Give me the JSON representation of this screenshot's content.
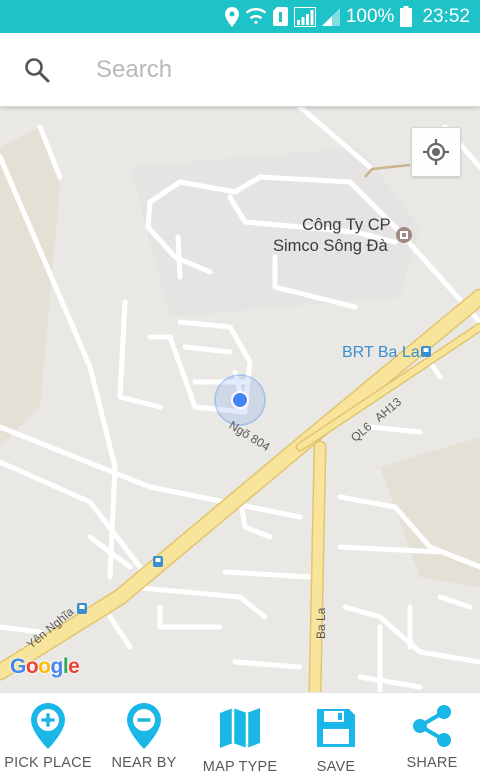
{
  "status_bar": {
    "battery_text": "100%",
    "time": "23:52",
    "icons": [
      "location-icon",
      "wifi-icon",
      "sim-icon",
      "signal-icon",
      "signal-icon",
      "battery-icon"
    ]
  },
  "search": {
    "placeholder": "Search",
    "icon": "search-icon"
  },
  "map": {
    "poi_name_line1": "Công Ty CP",
    "poi_name_line2": "Simco Sông Đà",
    "brt_station": "BRT Ba La",
    "road_ngo_804": "Ngõ 804",
    "road_ql6": "QL6",
    "road_ah13": "AH13",
    "road_ba_la": "Ba La",
    "road_yen_nghia": "Yên Nghĩa",
    "attribution": "Google",
    "colors": {
      "my_location_dot": "#4285f4",
      "highway": "#f8e49a",
      "land": "#e9e8e4"
    }
  },
  "bottom_nav": {
    "accent": "#1ab6e8",
    "items": [
      {
        "label": "PICK PLACE",
        "icon": "pin-plus-icon"
      },
      {
        "label": "NEAR BY",
        "icon": "pin-minus-icon"
      },
      {
        "label": "MAP TYPE",
        "icon": "map-icon"
      },
      {
        "label": "SAVE",
        "icon": "floppy-disk-icon"
      },
      {
        "label": "SHARE",
        "icon": "share-icon"
      }
    ]
  }
}
